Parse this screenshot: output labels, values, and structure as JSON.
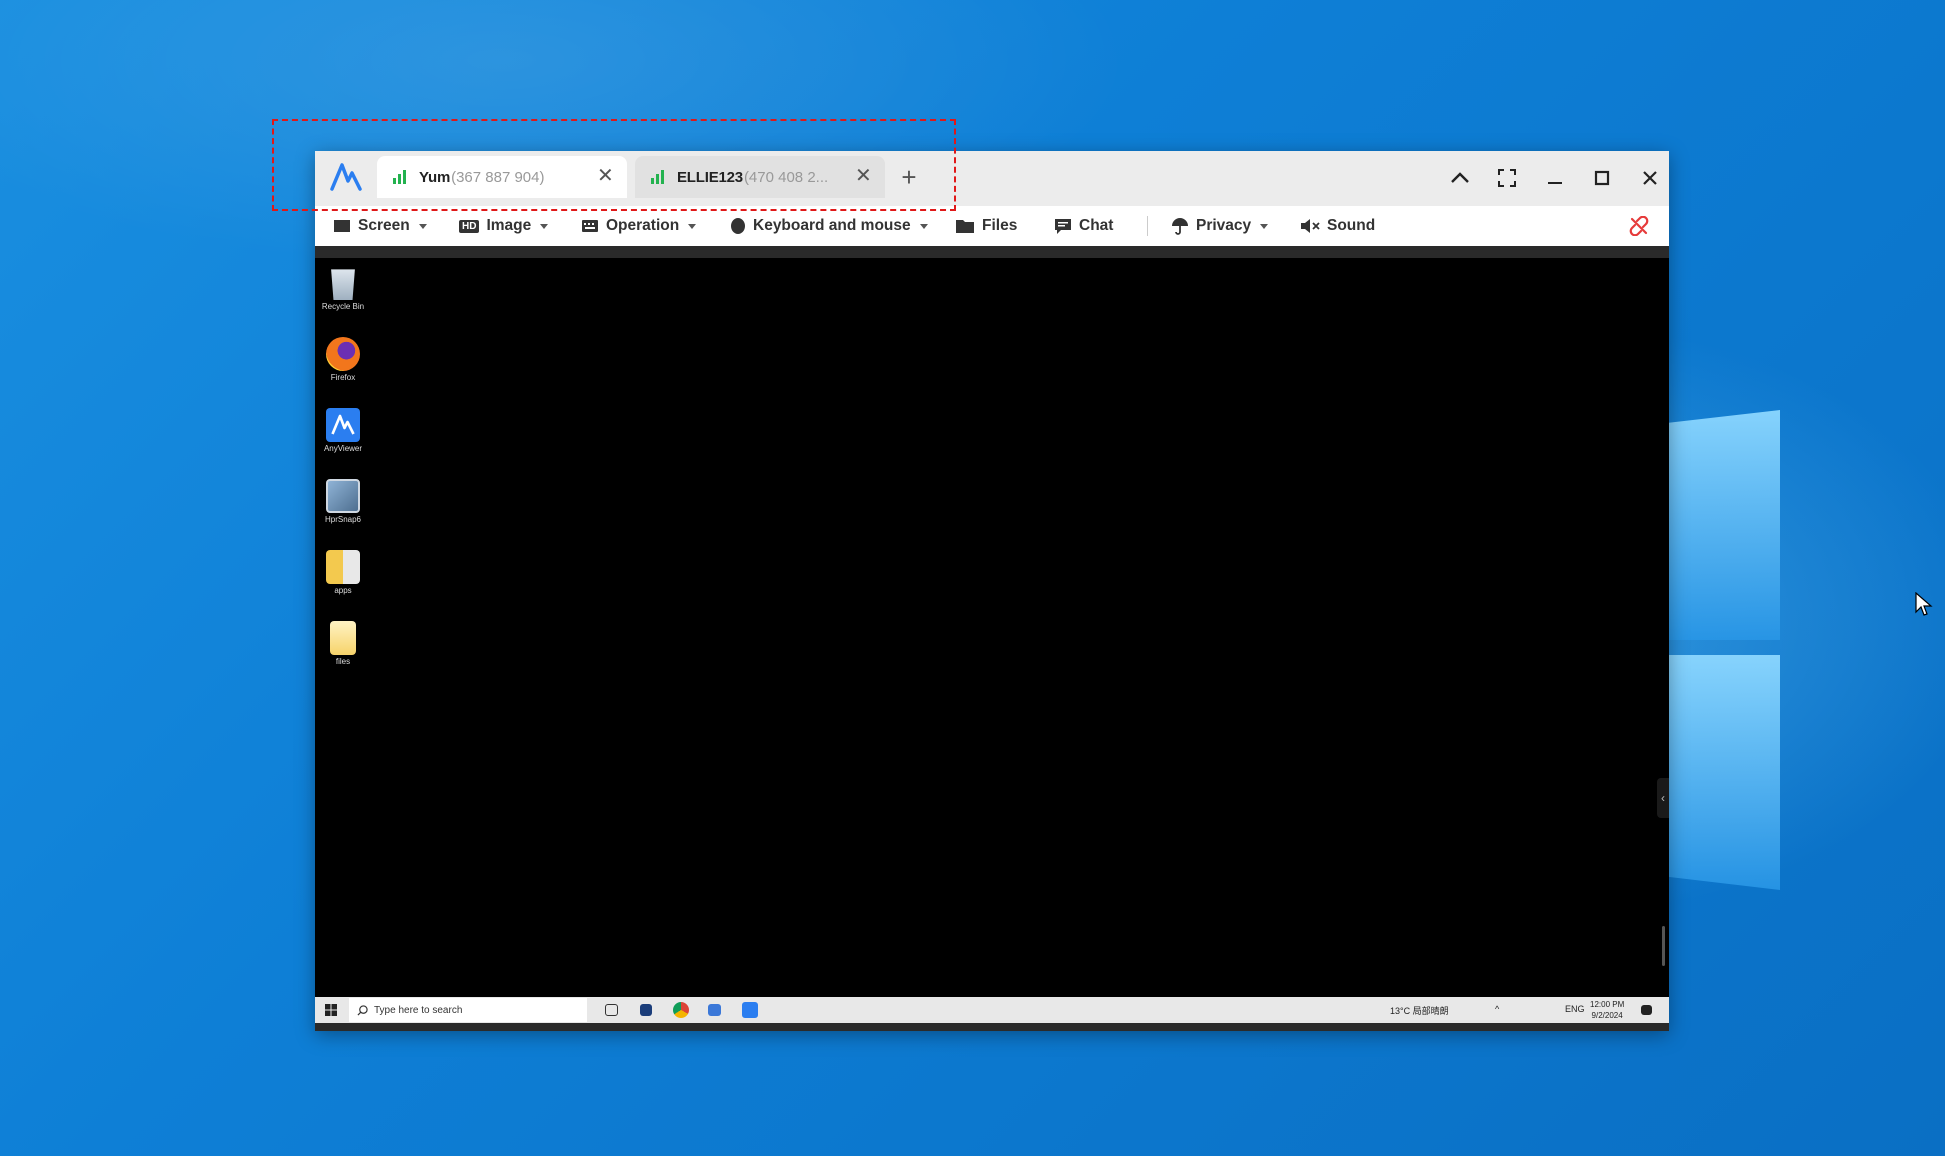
{
  "desktop": {
    "wallpaper": "windows-10-blue",
    "cursor": "mouse-pointer-icon"
  },
  "window": {
    "logo": "anyviewer-logo-icon",
    "tabs": [
      {
        "name": "Yum",
        "id": "(367 887 904)",
        "signal": "signal-bars-icon"
      },
      {
        "name": "ELLIE123",
        "id": "(470 408 2...",
        "signal": "signal-bars-icon"
      }
    ],
    "controls": [
      "chevron-up-icon",
      "fullscreen-icon",
      "minimize-icon",
      "maximize-icon",
      "close-icon"
    ]
  },
  "toolbar": {
    "screen": "Screen",
    "image": "Image",
    "image_badge": "HD",
    "operation": "Operation",
    "keyboard_mouse": "Keyboard and mouse",
    "files": "Files",
    "chat": "Chat",
    "privacy": "Privacy",
    "sound": "Sound"
  },
  "remote_desktop": {
    "icons": [
      {
        "label": "Recycle Bin",
        "icon": "recycle-bin-icon",
        "color": "#c9d3dd"
      },
      {
        "label": "Firefox",
        "icon": "firefox-icon",
        "color": "#f2761c"
      },
      {
        "label": "AnyViewer",
        "icon": "anyviewer-icon",
        "color": "#2b7ef0"
      },
      {
        "label": "HprSnap6",
        "icon": "hypersnap-icon",
        "color": "#6d8fb0"
      },
      {
        "label": "apps",
        "icon": "apps-icon",
        "color": "#f3c94e"
      },
      {
        "label": "files",
        "icon": "files-icon",
        "color": "#f6d36a"
      }
    ],
    "taskbar": {
      "search_placeholder": "Type here to search",
      "weather": "13°C",
      "weather_desc": "局部晴朗",
      "lang": "ENG",
      "time": "12:00 PM",
      "date": "9/2/2024"
    }
  },
  "annotation": {
    "highlight_color": "#e01818"
  }
}
